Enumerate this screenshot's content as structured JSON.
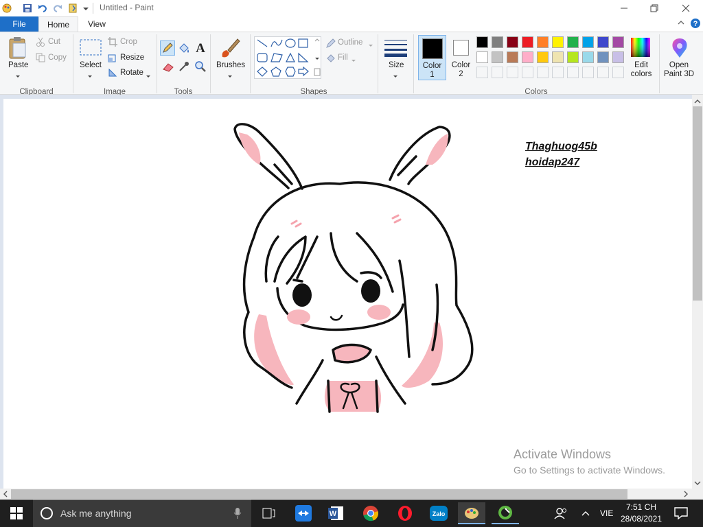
{
  "window": {
    "title": "Untitled - Paint"
  },
  "menu": {
    "file": "File",
    "home": "Home",
    "view": "View"
  },
  "ribbon": {
    "clipboard": {
      "label": "Clipboard",
      "paste": "Paste",
      "cut": "Cut",
      "copy": "Copy"
    },
    "image": {
      "label": "Image",
      "select": "Select",
      "crop": "Crop",
      "resize": "Resize",
      "rotate": "Rotate"
    },
    "tools": {
      "label": "Tools"
    },
    "brushes": {
      "label": "Brushes"
    },
    "shapes": {
      "label": "Shapes",
      "outline": "Outline",
      "fill": "Fill"
    },
    "size": {
      "label": "Size"
    },
    "colors": {
      "label": "Colors",
      "color1_line1": "Color",
      "color1_line2": "1",
      "color2_line1": "Color",
      "color2_line2": "2",
      "edit_line1": "Edit",
      "edit_line2": "colors",
      "paint3d_line1": "Open",
      "paint3d_line2": "Paint 3D",
      "palette_row1": [
        "#000000",
        "#7f7f7f",
        "#880015",
        "#ed1c24",
        "#ff7f27",
        "#fff200",
        "#22b14c",
        "#00a2e8",
        "#3f48cc",
        "#a349a4"
      ],
      "palette_row2": [
        "#ffffff",
        "#c3c3c3",
        "#b97a57",
        "#ffaec9",
        "#ffc90e",
        "#efe4b0",
        "#b5e61d",
        "#99d9ea",
        "#7092be",
        "#c8bfe7"
      ],
      "color1": "#000000",
      "color2": "#ffffff"
    }
  },
  "canvas": {
    "text_line1": "Thaghuog45b",
    "text_line2": "hoidap247"
  },
  "activation": {
    "title": "Activate Windows",
    "subtitle": "Go to Settings to activate Windows."
  },
  "taskbar": {
    "search_placeholder": "Ask me anything",
    "language": "VIE",
    "time": "7:51 CH",
    "date": "28/08/2021"
  }
}
